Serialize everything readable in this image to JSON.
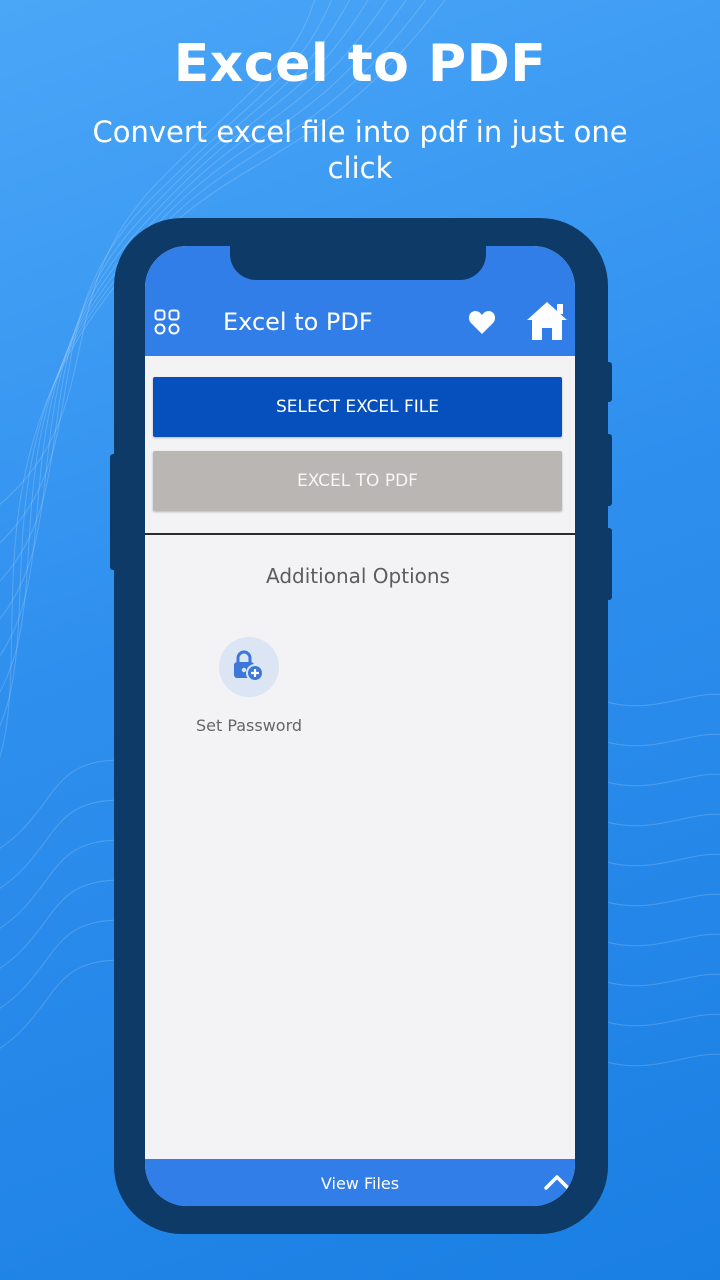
{
  "promo": {
    "headline": "Excel to PDF",
    "subline": "Convert excel file into pdf in just one click"
  },
  "app": {
    "title": "Excel to PDF",
    "icons": {
      "menu": "grid-icon",
      "favorite": "heart-icon",
      "home": "home-icon"
    },
    "buttons": {
      "select_label": "SELECT EXCEL FILE",
      "convert_label": "EXCEL TO PDF"
    },
    "options": {
      "title": "Additional Options",
      "items": [
        {
          "label": "Set Password",
          "icon": "lock-plus-icon"
        }
      ]
    },
    "bottom_bar": {
      "label": "View Files",
      "icon": "chevron-up-icon"
    }
  },
  "colors": {
    "background": "#2f8fee",
    "phone_frame": "#0d3a66",
    "app_bar": "#317ee8",
    "primary_button": "#0650bd",
    "disabled_button": "#b9b6b4"
  }
}
